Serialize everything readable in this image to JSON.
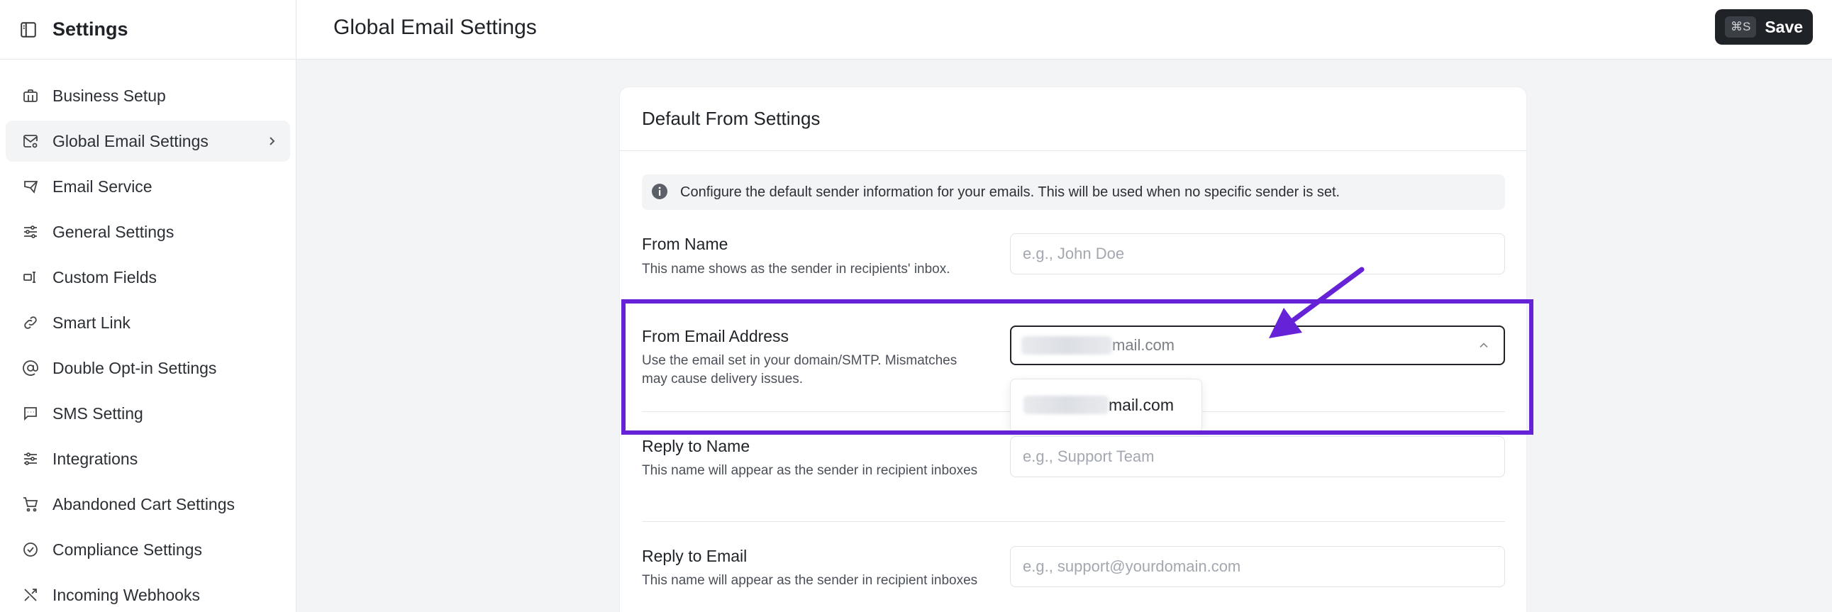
{
  "sidebar": {
    "title": "Settings",
    "items": [
      {
        "label": "Business Setup",
        "icon": "briefcase-icon"
      },
      {
        "label": "Global Email Settings",
        "icon": "mail-settings-icon",
        "active": true
      },
      {
        "label": "Email Service",
        "icon": "send-mail-icon"
      },
      {
        "label": "General Settings",
        "icon": "sliders-icon"
      },
      {
        "label": "Custom Fields",
        "icon": "custom-field-icon"
      },
      {
        "label": "Smart Link",
        "icon": "link-icon"
      },
      {
        "label": "Double Opt-in Settings",
        "icon": "at-sign-icon"
      },
      {
        "label": "SMS Setting",
        "icon": "message-icon"
      },
      {
        "label": "Integrations",
        "icon": "integrations-icon"
      },
      {
        "label": "Abandoned Cart Settings",
        "icon": "cart-icon"
      },
      {
        "label": "Compliance Settings",
        "icon": "check-circle-icon"
      },
      {
        "label": "Incoming Webhooks",
        "icon": "webhook-icon"
      }
    ]
  },
  "header": {
    "title": "Global Email Settings",
    "save_shortcut": "⌘S",
    "save_label": "Save"
  },
  "card": {
    "title": "Default From Settings",
    "info": "Configure the default sender information for your emails. This will be used when no specific sender is set.",
    "fields": {
      "from_name": {
        "label": "From Name",
        "help": "This name shows as the sender in recipients' inbox.",
        "placeholder": "e.g., John Doe",
        "value": ""
      },
      "from_email": {
        "label": "From Email Address",
        "help": "Use the email set in your domain/SMTP. Mismatches may cause delivery issues.",
        "value_suffix": "mail.com",
        "options": [
          {
            "suffix": "mail.com"
          }
        ]
      },
      "reply_name": {
        "label": "Reply to Name",
        "help": "This name will appear as the sender in recipient inboxes",
        "placeholder": "e.g., Support Team",
        "value": ""
      },
      "reply_email": {
        "label": "Reply to Email",
        "help": "This name will appear as the sender in recipient inboxes",
        "placeholder": "e.g., support@yourdomain.com",
        "value": ""
      }
    }
  },
  "annotation": {
    "color": "#6522d6"
  }
}
